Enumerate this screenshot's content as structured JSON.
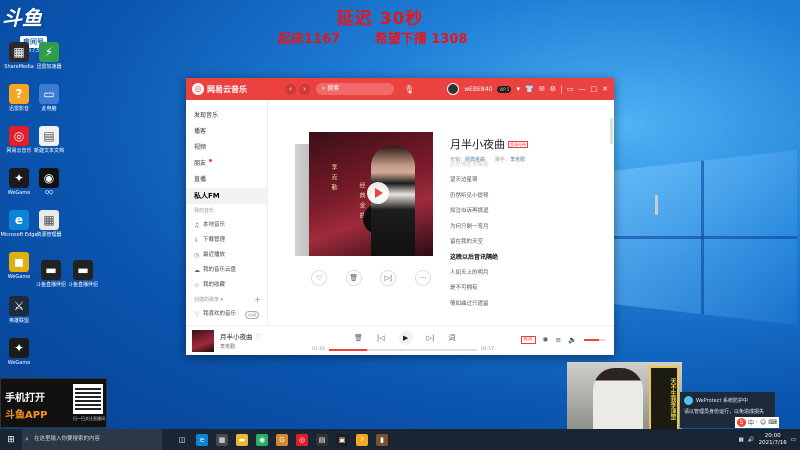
{
  "overlay": {
    "delay": "延迟  30秒",
    "wake": "起床1167",
    "hope": "希望下播 1308"
  },
  "douyu": {
    "room_label": "房间号",
    "room_number": "256737"
  },
  "desktop_icons": [
    {
      "label": "ShareMedia",
      "glyph": "▦",
      "color": "#2b2b2b"
    },
    {
      "label": "迅雷加速器",
      "glyph": "⚡",
      "color": "#2f9d4a"
    },
    {
      "label": "迅雷影音",
      "glyph": "?",
      "color": "#f5a623"
    },
    {
      "label": "此电脑",
      "glyph": "▭",
      "color": "#3a7bd5"
    },
    {
      "label": "网易云音乐",
      "glyph": "◎",
      "color": "#e11d2a"
    },
    {
      "label": "新建文本文档",
      "glyph": "▤",
      "color": "#f1f1f1"
    },
    {
      "label": "WeGame",
      "glyph": "✦",
      "color": "#1b1b1b"
    },
    {
      "label": "QQ",
      "glyph": "◉",
      "color": "#111111"
    },
    {
      "label": "Microsoft Edge",
      "glyph": "e",
      "color": "#0b84d8"
    },
    {
      "label": "资源管理器",
      "glyph": "▦",
      "color": "#e9e9e9"
    },
    {
      "label": "WeGame",
      "glyph": "◼",
      "color": "#e0b10e"
    },
    {
      "label": "斗鱼直播伴侣",
      "glyph": "▬",
      "color": "#222222"
    },
    {
      "label": "斗鱼直播伴侣",
      "glyph": "▬",
      "color": "#222222"
    },
    {
      "label": "英雄联盟",
      "glyph": "⚔",
      "color": "#1e2b3a"
    },
    {
      "label": "WeGame",
      "glyph": "✦",
      "color": "#1b1b1b"
    }
  ],
  "window": {
    "brand": "网易云音乐",
    "search_placeholder": "搜索",
    "username": "wEBE840",
    "vip": "VIP 5"
  },
  "sidebar": {
    "items": [
      "发现音乐",
      "播客",
      "视频",
      "朋友",
      "直播",
      "私人FM"
    ],
    "my_music_header": "我的音乐",
    "my_music": [
      {
        "icon": "♫",
        "label": "本地音乐"
      },
      {
        "icon": "⇩",
        "label": "下载管理"
      },
      {
        "icon": "◷",
        "label": "最近播放"
      },
      {
        "icon": "☁",
        "label": "我的音乐云盘"
      },
      {
        "icon": "☆",
        "label": "我的收藏"
      }
    ],
    "created_header": "创建的歌单",
    "created": [
      {
        "icon": "♡",
        "label": "我喜欢的音乐",
        "pill": "心动"
      }
    ]
  },
  "song": {
    "title": "月半小夜曲",
    "tag": "超清母带",
    "album_label": "专辑：",
    "album": "经典金曲",
    "artist_label": "歌手：",
    "artist": "李克勤"
  },
  "cover_text": {
    "left": "李克勤",
    "right": "经典金曲"
  },
  "lyrics": [
    {
      "text": "仍然倚在失眠夜",
      "state": "fade"
    },
    {
      "text": "望天边星宿",
      "state": "normal"
    },
    {
      "text": "仍然听见小提琴",
      "state": "normal"
    },
    {
      "text": "如泣似诉再挑逗",
      "state": "normal"
    },
    {
      "text": "为何只剩一弯月",
      "state": "normal"
    },
    {
      "text": "留在我的天空",
      "state": "normal"
    },
    {
      "text": "这晚以后音讯隔绝",
      "state": "current"
    },
    {
      "text": "人如天上的明月",
      "state": "normal"
    },
    {
      "text": "是不可拥有",
      "state": "normal"
    },
    {
      "text": "情如曲过只遗留",
      "state": "normal"
    }
  ],
  "player": {
    "title": "月半小夜曲",
    "artist": "李克勤",
    "elapsed": "01:16",
    "total": "04:57",
    "progress_fraction": 0.26,
    "quality": "极高",
    "volume_fraction": 0.7
  },
  "promo": {
    "line1": "手机打开",
    "line2": "斗鱼APP",
    "qr_caption": "扫一扫关注直播间"
  },
  "cam_banner": "天不生我李淳罡",
  "notification": {
    "title": "WeProtect 系统防护中",
    "body": "请以管理员身份运行，以免造成损失"
  },
  "taskbar": {
    "search_placeholder": "在这里输入你要搜索的内容",
    "time": "20:00",
    "date": "2021/7/16"
  }
}
